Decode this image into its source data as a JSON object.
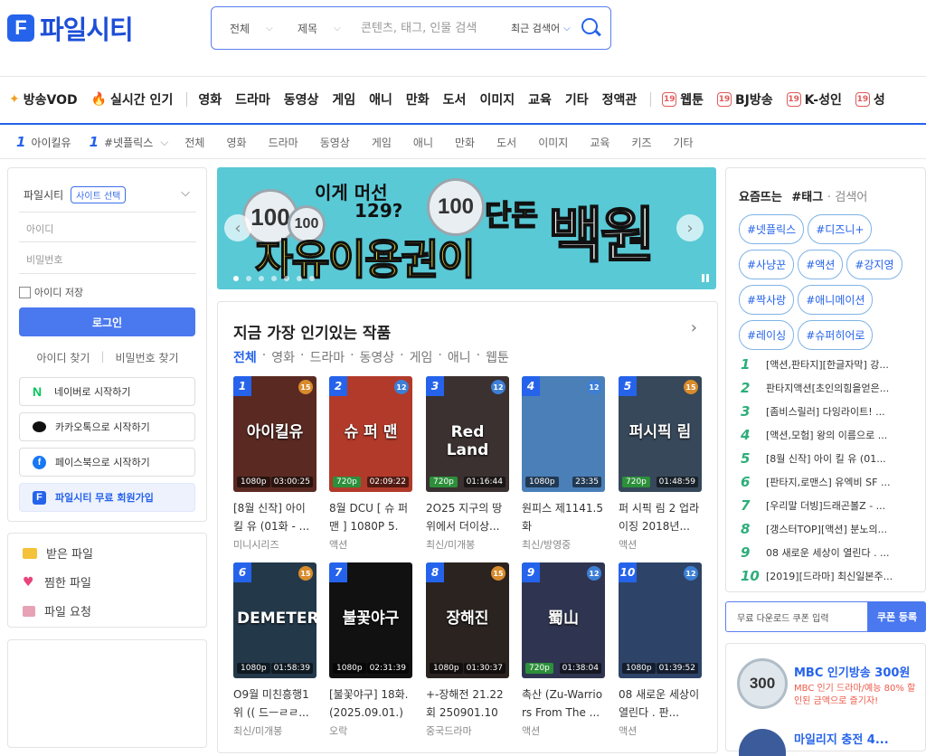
{
  "header": {
    "logo_text": "파일시티",
    "search": {
      "scope": "전체",
      "field": "제목",
      "placeholder": "콘텐츠, 태그, 인물 검색",
      "recent": "최근 검색어"
    }
  },
  "nav": {
    "main": [
      {
        "label": "방송VOD",
        "icon": "sparkle-icon"
      },
      {
        "label": "실시간 인기",
        "icon": "fire-icon"
      },
      {
        "label": "영화"
      },
      {
        "label": "드라마"
      },
      {
        "label": "동영상"
      },
      {
        "label": "게임"
      },
      {
        "label": "애니"
      },
      {
        "label": "만화"
      },
      {
        "label": "도서"
      },
      {
        "label": "이미지"
      },
      {
        "label": "교육"
      },
      {
        "label": "기타"
      },
      {
        "label": "정액관"
      },
      {
        "label": "웹툰",
        "badge": "19"
      },
      {
        "label": "BJ방송",
        "badge": "19"
      },
      {
        "label": "K-성인",
        "badge": "19"
      },
      {
        "label": "성",
        "badge": "19"
      }
    ],
    "ranking_left": {
      "rank": "1",
      "label": "아이킬유"
    },
    "ranking_right": {
      "rank": "1",
      "label": "#넷플릭스"
    },
    "sub": [
      "전체",
      "영화",
      "드라마",
      "동영상",
      "게임",
      "애니",
      "만화",
      "도서",
      "이미지",
      "교육",
      "키즈",
      "기타"
    ]
  },
  "login": {
    "site_label": "파일시티",
    "site_select": "사이트 선택",
    "id_placeholder": "아이디",
    "pw_placeholder": "비밀번호",
    "save_id": "아이디 저장",
    "login_button": "로그인",
    "find_id": "아이디 찾기",
    "find_pw": "비밀번호 찾기",
    "naver": "네이버로 시작하기",
    "kakao": "카카오톡으로 시작하기",
    "facebook": "페이스북으로 시작하기",
    "join": "파일시티 무료 회원가입"
  },
  "myfiles": {
    "received": "받은 파일",
    "liked": "찜한 파일",
    "request": "파일 요청"
  },
  "banner": {
    "line1": "이게 머선",
    "line2": "129?",
    "line3": "단돈",
    "line4": "자유이용권이",
    "line5": "백원",
    "coin_big": "100",
    "coin_small": "100",
    "coin_right": "100"
  },
  "popular": {
    "title": "지금 가장 인기있는 작품",
    "tabs": [
      "전체",
      "영화",
      "드라마",
      "동영상",
      "게임",
      "애니",
      "웹툰"
    ],
    "items": [
      {
        "rank": "1",
        "age": "15",
        "res": "1080p",
        "dur": "03:00:25",
        "thumb_text": "아이킬유",
        "name": "[8월 신작] 아이 킬 유 (01화 - ...",
        "sub": "미니시리즈",
        "bg": "#5a2a22"
      },
      {
        "rank": "2",
        "age": "12",
        "res": "720p",
        "dur": "02:09:22",
        "thumb_text": "슈 퍼 맨",
        "name": "8월 DCU [ 슈 퍼 맨 ] 1080P 5.1...",
        "sub": "액션",
        "bg": "#b23a2a"
      },
      {
        "rank": "3",
        "age": "12",
        "res": "720p",
        "dur": "01:16:44",
        "thumb_text": "Red Land",
        "name": "2O25 지구의 땅 위에서 더이상...",
        "sub": "최신/미개봉",
        "bg": "#3a3130"
      },
      {
        "rank": "4",
        "age": "12",
        "res": "1080p",
        "dur": "23:35",
        "thumb_text": "",
        "name": "원피스 제1141.5화",
        "sub": "최신/방영중",
        "bg": "#4a7fb8"
      },
      {
        "rank": "5",
        "age": "15",
        "res": "720p",
        "dur": "01:48:59",
        "thumb_text": "퍼시픽 림",
        "name": "퍼 시픽 림 2 업라이징 2018년...",
        "sub": "액션",
        "bg": "#36485a"
      },
      {
        "rank": "6",
        "age": "15",
        "res": "1080p",
        "dur": "01:58:39",
        "thumb_text": "DEMETER",
        "name": "O9월 미친흥행1위 (( 드ㅡㄹㄹ...",
        "sub": "최신/미개봉",
        "bg": "#23394a"
      },
      {
        "rank": "7",
        "age": "",
        "res": "1080p",
        "dur": "02:31:39",
        "thumb_text": "불꽃야구",
        "name": "[불꽃야구] 18화. (2025.09.01.) ...",
        "sub": "오락",
        "bg": "#111111"
      },
      {
        "rank": "8",
        "age": "15",
        "res": "1080p",
        "dur": "01:30:37",
        "thumb_text": "장해진",
        "name": "+-장해전 21.22회 250901.108...",
        "sub": "중국드라마",
        "bg": "#2a2320"
      },
      {
        "rank": "9",
        "age": "12",
        "res": "720p",
        "dur": "01:38:04",
        "thumb_text": "蜀山",
        "name": "촉산 (Zu-Warriors From The ...",
        "sub": "액션",
        "bg": "#2f3550"
      },
      {
        "rank": "10",
        "age": "12",
        "res": "1080p",
        "dur": "01:39:52",
        "thumb_text": "",
        "name": "08 새로운 세상이 열린다 . 판...",
        "sub": "액션",
        "bg": "#2d4468"
      }
    ]
  },
  "trend": {
    "title": "요즘뜨는",
    "title_tag": "#태그",
    "title_sep": "·",
    "title_search": "검색어",
    "tags": [
      "#넷플릭스",
      "#디즈니+",
      "#사냥꾼",
      "#액션",
      "#강지영",
      "#짝사랑",
      "#애니메이션",
      "#레이싱",
      "#슈퍼히어로"
    ],
    "ranks": [
      {
        "n": "1",
        "t": "[액션,판타지][한글자막] 강..."
      },
      {
        "n": "2",
        "t": "판타지액션[초인의힘을얻은..."
      },
      {
        "n": "3",
        "t": "[좀비스릴러] 다잉라이트! ..."
      },
      {
        "n": "4",
        "t": "[액션,모험] 왕의 이름으로 ..."
      },
      {
        "n": "5",
        "t": "[8월 신작] 아이 킬 유 (01..."
      },
      {
        "n": "6",
        "t": "[판타지,로맨스] 유엑비 SF ..."
      },
      {
        "n": "7",
        "t": "[우리말 더빙]드래곤볼Z - ..."
      },
      {
        "n": "8",
        "t": "[갱스터TOP][액션] 분노의..."
      },
      {
        "n": "9",
        "t": "08 새로운 세상이 열린다 . ..."
      },
      {
        "n": "10",
        "t": "[2019][드라마] 최신일본주..."
      }
    ]
  },
  "coupon": {
    "placeholder": "무료 다운로드 쿠폰 입력",
    "button": "쿠폰 등록"
  },
  "promo": {
    "seal": "300",
    "title": "MBC 인기방송 300원",
    "subtitle": "MBC 인기 드라마/예능 80% 할인된 금액으로 즐기자!",
    "title2": "마일리지 충전 4..."
  }
}
